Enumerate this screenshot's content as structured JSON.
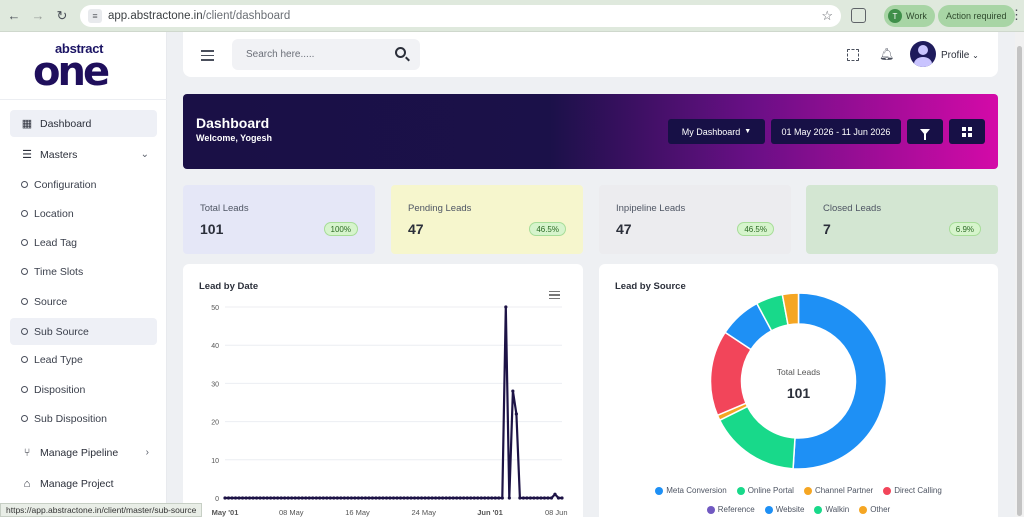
{
  "browser": {
    "url_host": "app.abstractone.in",
    "url_path": "/client/dashboard",
    "profile_chip": "Work",
    "profile_initial": "T",
    "action_chip": "Action required"
  },
  "logo": {
    "top": "abstract",
    "main": "one"
  },
  "sidebar": {
    "items": [
      {
        "label": "Dashboard",
        "icon": "dashboard-grid-icon"
      },
      {
        "label": "Masters",
        "icon": "list-icon"
      },
      {
        "label": "Configuration"
      },
      {
        "label": "Location"
      },
      {
        "label": "Lead Tag"
      },
      {
        "label": "Time Slots"
      },
      {
        "label": "Source"
      },
      {
        "label": "Sub Source"
      },
      {
        "label": "Lead Type"
      },
      {
        "label": "Disposition"
      },
      {
        "label": "Sub Disposition"
      },
      {
        "label": "Manage Pipeline",
        "icon": "pipeline-icon"
      },
      {
        "label": "Manage Project",
        "icon": "project-icon"
      }
    ]
  },
  "header": {
    "search_placeholder": "Search here.....",
    "profile_label": "Profile"
  },
  "hero": {
    "title": "Dashboard",
    "welcome": "Welcome, Yogesh",
    "dropdown_label": "My Dashboard",
    "date_range": "01 May 2026 - 11 Jun 2026"
  },
  "stats": [
    {
      "label": "Total Leads",
      "value": "101",
      "pct": "100%"
    },
    {
      "label": "Pending Leads",
      "value": "47",
      "pct": "46.5%"
    },
    {
      "label": "Inpipeline Leads",
      "value": "47",
      "pct": "46.5%"
    },
    {
      "label": "Closed Leads",
      "value": "7",
      "pct": "6.9%"
    }
  ],
  "chart_data": [
    {
      "type": "line",
      "title": "Lead by Date",
      "ylim": [
        0,
        50
      ],
      "yticks": [
        0,
        10,
        20,
        30,
        40,
        50
      ],
      "xtick_labels": [
        "May '01",
        "08 May",
        "16 May",
        "24 May",
        "Jun '01",
        "08 Jun"
      ],
      "color": "#1d1346",
      "series": [
        {
          "values": [
            0,
            0,
            0,
            0,
            0,
            0,
            0,
            0,
            0,
            0,
            0,
            0,
            0,
            0,
            0,
            0,
            0,
            0,
            0,
            0,
            0,
            0,
            0,
            0,
            0,
            0,
            0,
            0,
            0,
            0,
            0,
            0,
            0,
            0,
            0,
            0,
            0,
            0,
            0,
            0,
            0,
            0,
            0,
            0,
            0,
            0,
            0,
            0,
            0,
            0,
            0,
            0,
            0,
            0,
            0,
            0,
            0,
            0,
            0,
            0,
            0,
            0,
            0,
            0,
            0,
            0,
            0,
            0,
            0,
            0,
            0,
            0,
            0,
            0,
            0,
            0,
            0,
            0,
            0,
            0,
            50,
            0,
            28,
            22,
            0,
            0,
            0,
            0,
            0,
            0,
            0,
            0,
            0,
            0,
            1,
            0,
            0
          ]
        }
      ]
    },
    {
      "type": "pie",
      "title": "Lead by Source",
      "center_label": "Total Leads",
      "center_value": "101",
      "slices": [
        {
          "name": "Meta Conversion",
          "value": 52,
          "color": "#1e90f5"
        },
        {
          "name": "Online Portal",
          "value": 17,
          "color": "#18d98a"
        },
        {
          "name": "Channel Partner",
          "value": 1,
          "color": "#f5a623"
        },
        {
          "name": "Direct Calling",
          "value": 16,
          "color": "#f2455a"
        },
        {
          "name": "Reference",
          "value": 0,
          "color": "#7159c1"
        },
        {
          "name": "Website",
          "value": 8,
          "color": "#1e90f5"
        },
        {
          "name": "Walkin",
          "value": 5,
          "color": "#18d98a"
        },
        {
          "name": "Other",
          "value": 3,
          "color": "#f5a623"
        }
      ]
    }
  ],
  "status_url": "https://app.abstractone.in/client/master/sub-source"
}
